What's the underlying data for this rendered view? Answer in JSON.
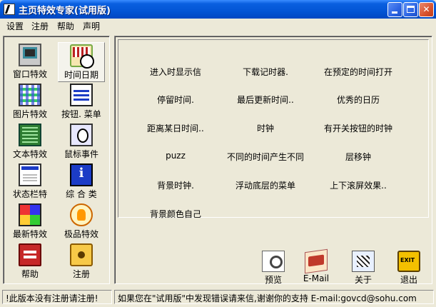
{
  "window": {
    "title": "主页特效专家(试用版)",
    "controls": [
      "minimize",
      "maximize",
      "close"
    ]
  },
  "menu": {
    "items": [
      "设置",
      "注册",
      "帮助",
      "声明"
    ]
  },
  "sidebar": {
    "items": [
      {
        "label": "窗口特效",
        "icon": "monitor-icon"
      },
      {
        "label": "时间日期",
        "icon": "clock-calendar-icon",
        "selected": true
      },
      {
        "label": "图片特效",
        "icon": "image-grid-icon"
      },
      {
        "label": "按钮. 菜单",
        "icon": "buttons-menu-icon"
      },
      {
        "label": "文本特效",
        "icon": "text-icon"
      },
      {
        "label": "鼠标事件",
        "icon": "mouse-icon"
      },
      {
        "label": "状态栏特",
        "icon": "statusbar-icon"
      },
      {
        "label": "综 合 类",
        "icon": "info-icon"
      },
      {
        "label": "最新特效",
        "icon": "new-effects-icon"
      },
      {
        "label": "极品特效",
        "icon": "premium-icon"
      },
      {
        "label": "帮助",
        "icon": "help-book-icon"
      },
      {
        "label": "注册",
        "icon": "register-safe-icon"
      }
    ]
  },
  "effects": [
    "进入时显示信",
    "下载记时器.",
    "在预定的时间打开",
    "停留时间.",
    "最后更新时间..",
    "优秀的日历",
    "距离某日时间..",
    "时钟",
    "有开关按钮的时钟",
    "puzz",
    "不同的时间产生不同",
    "层移钟",
    "背景时钟.",
    "浮动底层的菜单",
    "上下滚屏效果..",
    "背景颜色自己"
  ],
  "actions": [
    {
      "label": "预览",
      "icon": "preview-icon"
    },
    {
      "label": "E-Mail",
      "icon": "email-icon"
    },
    {
      "label": "关于",
      "icon": "about-icon"
    },
    {
      "label": "退出",
      "icon": "exit-icon"
    }
  ],
  "status": {
    "left": "!此版本没有注册请注册!",
    "right": "如果您在\"试用版\"中发现错误请来信,谢谢你的支持 E-mail:govcd@sohu.com"
  },
  "colors": {
    "titlebar": "#0355D5",
    "chrome": "#ECE9D8"
  }
}
